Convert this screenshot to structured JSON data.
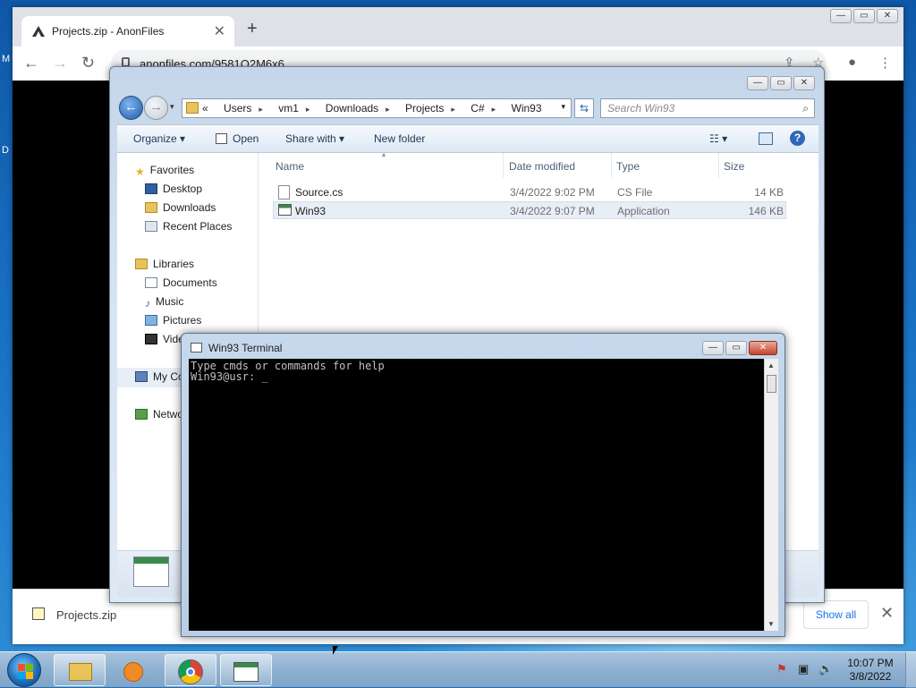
{
  "desktop": {
    "left_stub_1": "M",
    "left_stub_2": "D"
  },
  "browser": {
    "tab_title": "Projects.zip - AnonFiles",
    "tab_close": "✕",
    "new_tab": "+",
    "url": "anonfiles.com/9581Q2M6x6",
    "back": "←",
    "forward": "→",
    "reload": "↻",
    "share_icon": "⇪",
    "star_icon": "☆",
    "profile_icon": "●",
    "menu_icon": "⋮",
    "download": {
      "filename": "Projects.zip",
      "show_all": "Show all",
      "close": "✕"
    },
    "controls": {
      "minimize": "—",
      "maximize": "▭",
      "close": "✕"
    }
  },
  "explorer": {
    "breadcrumb": [
      "«",
      "Users",
      "vm1",
      "Downloads",
      "Projects",
      "C#",
      "Win93"
    ],
    "search_placeholder": "Search Win93",
    "toolbar": {
      "organize": "Organize ▾",
      "open": "Open",
      "share_with": "Share with ▾",
      "new_folder": "New folder"
    },
    "nav": {
      "favorites": "Favorites",
      "desktop": "Desktop",
      "downloads": "Downloads",
      "recent": "Recent Places",
      "libraries": "Libraries",
      "documents": "Documents",
      "music": "Music",
      "pictures": "Pictures",
      "videos": "Vide",
      "computer": "My Co",
      "network": "Netwo"
    },
    "columns": {
      "name": "Name",
      "date": "Date modified",
      "type": "Type",
      "size": "Size"
    },
    "files": [
      {
        "name": "Source.cs",
        "date": "3/4/2022 9:02 PM",
        "type": "CS File",
        "size": "14 KB"
      },
      {
        "name": "Win93",
        "date": "3/4/2022 9:07 PM",
        "type": "Application",
        "size": "146 KB"
      }
    ],
    "controls": {
      "minimize": "—",
      "maximize": "▭",
      "close": "✕"
    }
  },
  "terminal": {
    "title": "Win93 Terminal",
    "line1": "Type cmds or commands for help",
    "prompt": "Win93@usr: ",
    "cursor": "_",
    "controls": {
      "minimize": "—",
      "maximize": "▭",
      "close": "✕"
    }
  },
  "taskbar": {
    "clock_time": "10:07 PM",
    "clock_date": "3/8/2022"
  },
  "colors": {
    "accent": "#1a73e8",
    "taskbar": "#8fb0d0",
    "terminal_bg": "#000000"
  }
}
